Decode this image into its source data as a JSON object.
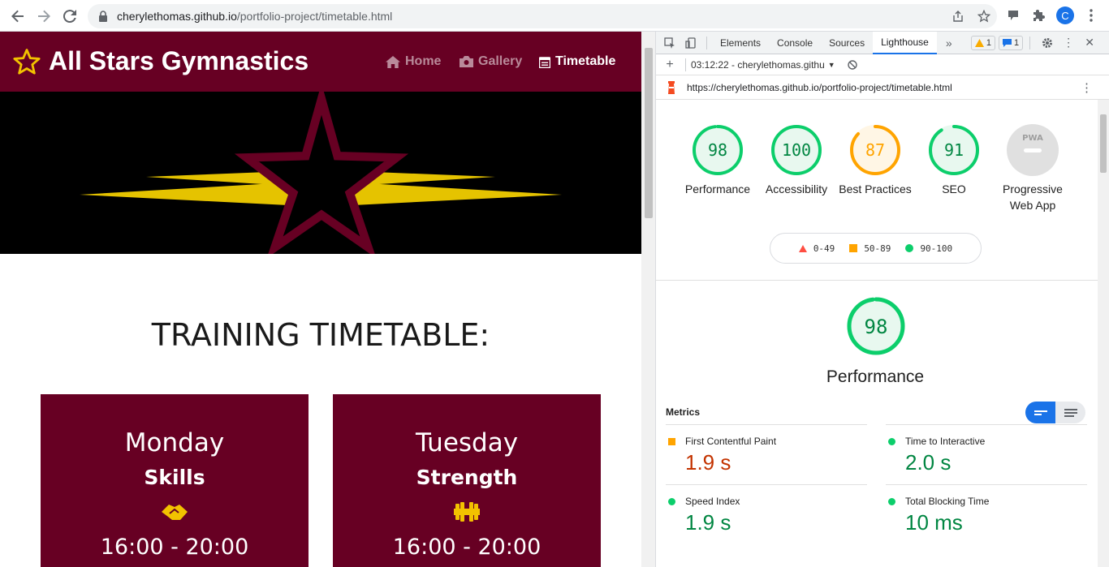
{
  "browser": {
    "url_host": "cherylethomas.github.io",
    "url_path": "/portfolio-project/timetable.html",
    "avatar_letter": "C"
  },
  "site": {
    "brand": "All Stars Gymnastics",
    "nav": [
      {
        "label": "Home",
        "icon": "home-icon"
      },
      {
        "label": "Gallery",
        "icon": "camera-icon"
      },
      {
        "label": "Timetable",
        "icon": "calendar-icon",
        "active": true
      }
    ],
    "heading": "TRAINING TIMETABLE:",
    "days": [
      {
        "day": "Monday",
        "type": "Skills",
        "icon": "handshake-icon",
        "time": "16:00 - 20:00"
      },
      {
        "day": "Tuesday",
        "type": "Strength",
        "icon": "dumbbell-icon",
        "time": "16:00 - 20:00"
      }
    ],
    "colors": {
      "brand": "#670023",
      "accent": "#f2c200"
    }
  },
  "devtools": {
    "tabs": [
      "Elements",
      "Console",
      "Sources",
      "Lighthouse"
    ],
    "active_tab": "Lighthouse",
    "warnings": "1",
    "messages": "1",
    "report_time": "03:12:22 - cherylethomas.githu",
    "report_url": "https://cherylethomas.github.io/portfolio-project/timetable.html",
    "scores": [
      {
        "label": "Performance",
        "value": "98",
        "score": 98
      },
      {
        "label": "Accessibility",
        "value": "100",
        "score": 100
      },
      {
        "label": "Best Practices",
        "value": "87",
        "score": 87
      },
      {
        "label": "SEO",
        "value": "91",
        "score": 91
      },
      {
        "label": "Progressive Web App",
        "value": "PWA",
        "score": null
      }
    ],
    "legend": [
      {
        "range": "0-49",
        "shape": "triangle",
        "color": "#ff4e42"
      },
      {
        "range": "50-89",
        "shape": "square",
        "color": "#ffa400"
      },
      {
        "range": "90-100",
        "shape": "circle",
        "color": "#0cce6b"
      }
    ],
    "performance_score": "98",
    "performance_title": "Performance",
    "metrics_heading": "Metrics",
    "metrics": [
      {
        "name": "First Contentful Paint",
        "value": "1.9 s",
        "status": "average",
        "color": "#c33300"
      },
      {
        "name": "Time to Interactive",
        "value": "2.0 s",
        "status": "pass",
        "color": "#018642"
      },
      {
        "name": "Speed Index",
        "value": "1.9 s",
        "status": "pass",
        "color": "#018642"
      },
      {
        "name": "Total Blocking Time",
        "value": "10 ms",
        "status": "pass",
        "color": "#018642"
      }
    ]
  }
}
